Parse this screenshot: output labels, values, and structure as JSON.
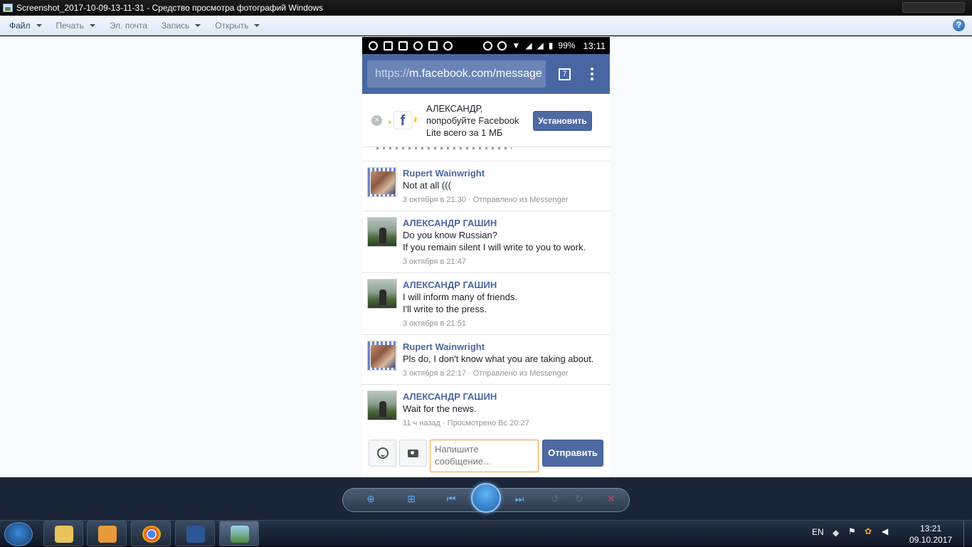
{
  "window": {
    "title": "Screenshot_2017-10-09-13-11-31 - Средство просмотра фотографий Windows"
  },
  "menu": {
    "file": "Файл",
    "print": "Печать",
    "email": "Эл. почта",
    "burn": "Запись",
    "open": "Открыть",
    "help": "?"
  },
  "phone": {
    "status": {
      "battery": "99%",
      "time": "13:11"
    },
    "browser": {
      "url_scheme": "https://",
      "url_host": "m.facebook.com/message",
      "tab_count": "7"
    },
    "promo": {
      "close": "×",
      "logo": "f",
      "text": "АЛЕКСАНДР, попробуйте Facebook Lite всего за 1 МБ",
      "install": "Установить"
    },
    "messages": [
      {
        "author": "Rupert Wainwright",
        "lines": [
          "Not at all ((("
        ],
        "meta": "3 октября в 21:30 · Отправлено из Messenger"
      },
      {
        "author": "АЛЕКСАНДР ГАШИН",
        "lines": [
          "Do you know Russian?",
          "If you remain silent I will write to you to work."
        ],
        "meta": "3 октября в 21:47"
      },
      {
        "author": "АЛЕКСАНДР ГАШИН",
        "lines": [
          "I will inform many of friends.",
          "I'll write to the press."
        ],
        "meta": "3 октября в 21:51"
      },
      {
        "author": "Rupert Wainwright",
        "lines": [
          "Pls do, I don't know what you are taking about."
        ],
        "meta": "3 октября в 22:17 · Отправлено из Messenger"
      },
      {
        "author": "АЛЕКСАНДР ГАШИН",
        "lines": [
          "Wait for the news."
        ],
        "meta": "11 ч назад · Просмотрено Вс 20:27"
      }
    ],
    "composer": {
      "placeholder": "Напишите сообщение...",
      "send": "Отправить"
    }
  },
  "taskbar": {
    "lang": "EN",
    "time": "13:21",
    "date": "09.10.2017"
  },
  "colors": {
    "facebook_blue": "#4867a2",
    "link": "#4b67a1"
  }
}
